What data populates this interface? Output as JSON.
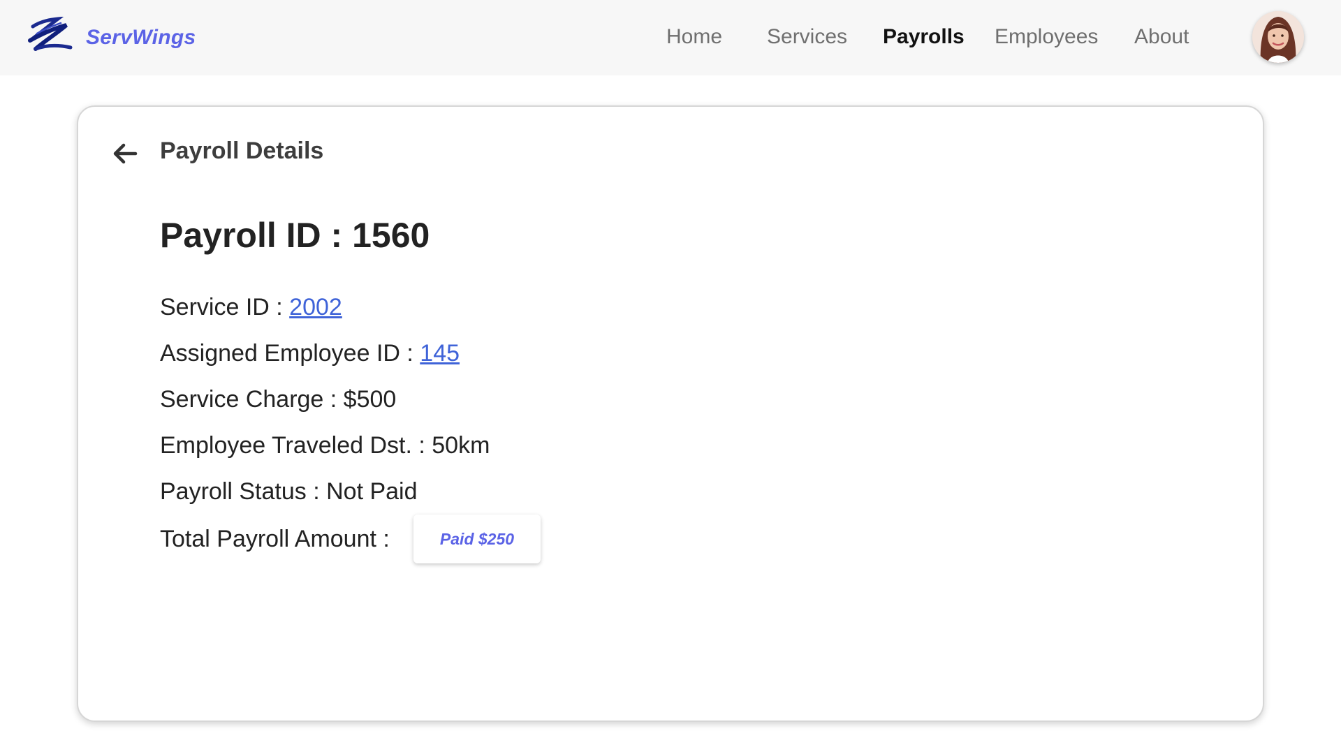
{
  "brand": {
    "name": "ServWings",
    "logo_icon": "servwings-logo-icon",
    "accent_color": "#5b63e6"
  },
  "nav": {
    "items": [
      {
        "label": "Home",
        "active": false
      },
      {
        "label": "Services",
        "active": false
      },
      {
        "label": "Payrolls",
        "active": true
      },
      {
        "label": "Employees",
        "active": false
      },
      {
        "label": "About",
        "active": false
      }
    ],
    "avatar_icon": "user-avatar"
  },
  "card": {
    "back_icon": "arrow-left-icon",
    "title": "Payroll Details",
    "payroll_heading": "Payroll ID : 1560",
    "details": {
      "service_id_label": "Service ID :",
      "service_id_value": "2002",
      "employee_id_label": "Assigned Employee ID :",
      "employee_id_value": "145",
      "service_charge": "Service Charge : $500",
      "traveled_distance": "Employee Traveled Dst. : 50km",
      "payroll_status": "Payroll Status : Not Paid",
      "total_amount_label": "Total Payroll Amount :",
      "total_amount_button": "Paid $250"
    },
    "link_color": "#3f63d8"
  }
}
